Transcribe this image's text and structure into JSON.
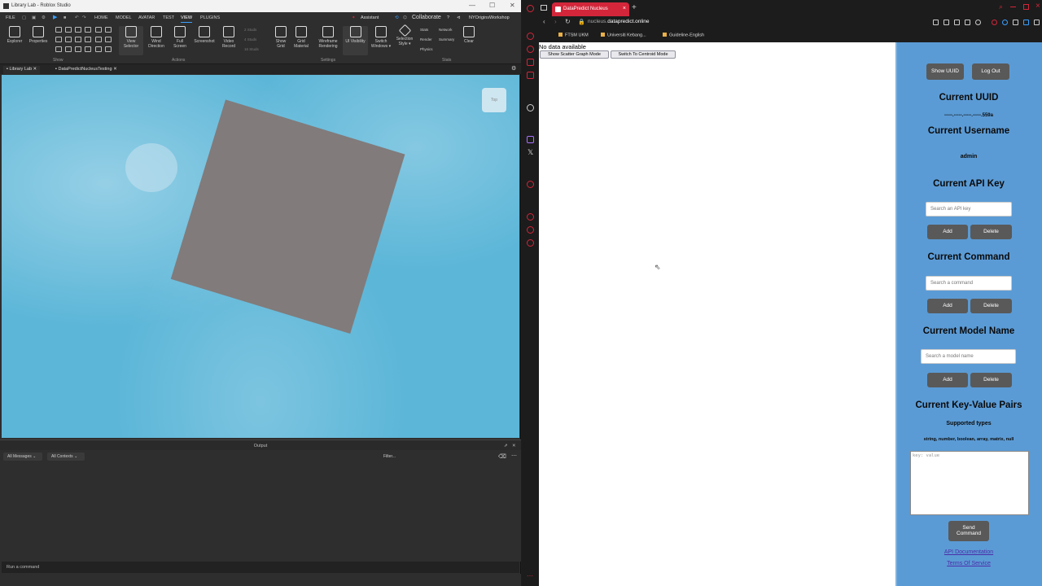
{
  "studio": {
    "window_title": "Library Lab - Roblox Studio",
    "menu": [
      "FILE",
      "HOME",
      "MODEL",
      "AVATAR",
      "TEST",
      "VIEW",
      "PLUGINS"
    ],
    "active_menu": "VIEW",
    "assistant": "Assistant",
    "collaborate": "Collaborate",
    "workspace": "NYOriginsWorkshop",
    "ribbon": {
      "explorer": "Explorer",
      "properties": "Properties",
      "view_selector": [
        "View",
        "Selector"
      ],
      "wind_direction": [
        "Wind",
        "Direction"
      ],
      "full_screen": [
        "Full",
        "Screen"
      ],
      "screenshot": "Screenshot",
      "video_record": [
        "Video",
        "Record"
      ],
      "studs_2": "2 Studs",
      "studs_4": "4 Studs",
      "studs_16": "16 Studs",
      "show_grid": [
        "Show",
        "Grid"
      ],
      "grid_material": [
        "Grid",
        "Material"
      ],
      "wireframe_rendering": [
        "Wireframe",
        "Rendering"
      ],
      "ui_visibility": "UI Visibility",
      "switch_windows": [
        "Switch",
        "Windows ▾"
      ],
      "selection_style": [
        "Selection",
        "Style ▾"
      ],
      "stats": "Stats",
      "network": "Network",
      "render": "Render",
      "summary": "Summary",
      "physics": "Physics",
      "clear": "Clear",
      "sections": [
        "Show",
        "Actions",
        "Settings",
        "Stats"
      ]
    },
    "tabs": [
      "Library Lab",
      "DataPredictNucleusTesting"
    ],
    "viewcube_label": "Top",
    "output": {
      "title": "Output",
      "filter_messages": "All Messages",
      "filter_contexts": "All Contexts",
      "filter_placeholder": "Filter..."
    },
    "command_placeholder": "Run a command"
  },
  "browser": {
    "tab_title": "DataPredict Nucleus",
    "url_prefix": "nucleus.",
    "url_domain": "datapredict.online",
    "bookmarks": [
      "FTSM UKM",
      "Universiti Kebang...",
      "Guideline-English"
    ],
    "page": {
      "status": "No data available",
      "btn_scatter": "Show Scatter Graph Mode",
      "btn_centroid": "Switch To Centroid Mode",
      "btn_show_uuid": "Show UUID",
      "btn_logout": "Log Out",
      "h_uuid": "Current UUID",
      "uuid_value": "-----.-----.-----.-----.559a",
      "h_username": "Current Username",
      "username_value": "admin",
      "h_api_key": "Current API Key",
      "api_key_placeholder": "Search an API key",
      "h_command": "Current Command",
      "command_placeholder": "Search a command",
      "h_model": "Current Model Name",
      "model_placeholder": "Search a model name",
      "add": "Add",
      "delete": "Delete",
      "h_kv": "Current Key-Value Pairs",
      "supported_types_label": "Supported types",
      "supported_types": "string, number, boolean, array, matrix, null",
      "kv_placeholder": "key: value",
      "send_command": [
        "Send",
        "Command"
      ],
      "link_api_docs": "API Documentation",
      "link_tos": "Terms Of Service"
    }
  },
  "colors": {
    "accent_red": "#d3263a",
    "panel_blue": "#5b9bd5",
    "sky": "#5cb6d8",
    "baseplate": "#817b7b"
  }
}
